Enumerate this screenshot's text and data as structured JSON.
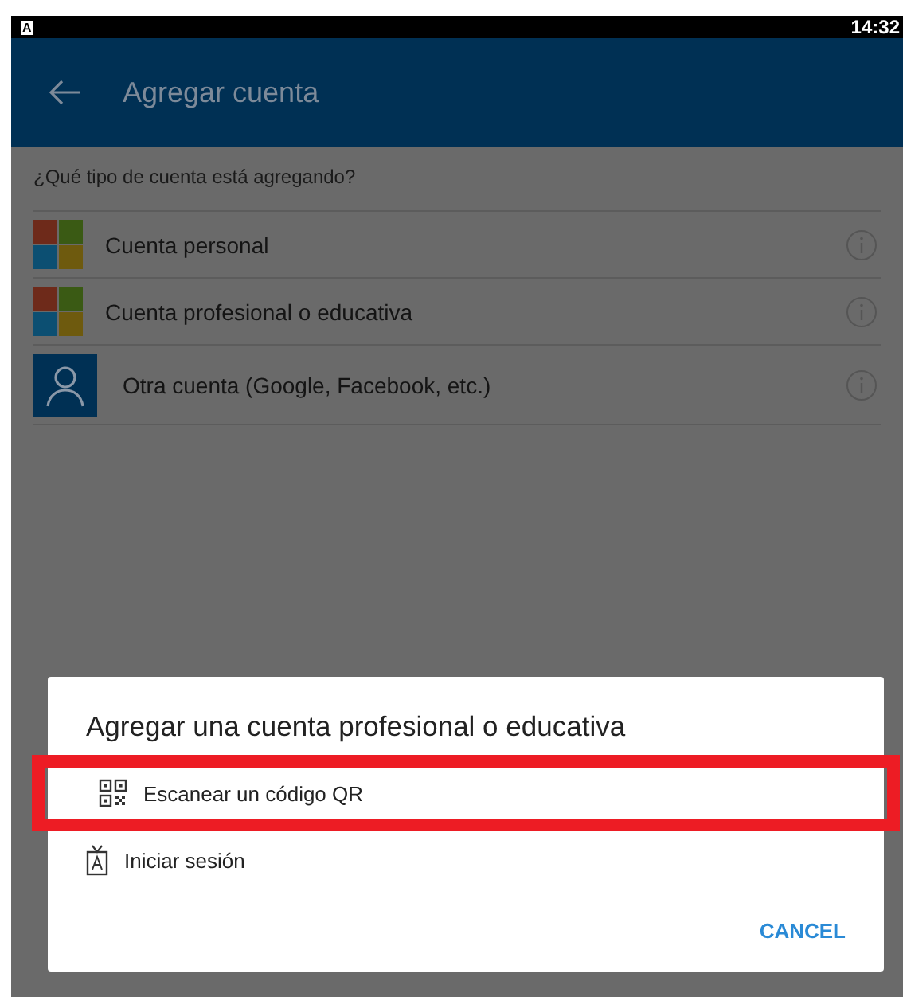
{
  "status_bar": {
    "notification": "A",
    "time": "14:32"
  },
  "app_bar": {
    "title": "Agregar cuenta"
  },
  "prompt": "¿Qué tipo de cuenta está agregando?",
  "account_types": [
    {
      "kind": "microsoft",
      "label": "Cuenta personal"
    },
    {
      "kind": "microsoft",
      "label": "Cuenta profesional o educativa"
    },
    {
      "kind": "person",
      "label": "Otra cuenta (Google, Facebook, etc.)"
    }
  ],
  "dialog": {
    "title": "Agregar una cuenta profesional o educativa",
    "options": [
      {
        "kind": "qr",
        "label": "Escanear un código QR",
        "highlighted": true
      },
      {
        "kind": "badge",
        "label": "Iniciar sesión",
        "highlighted": false
      }
    ],
    "cancel": "CANCEL"
  }
}
